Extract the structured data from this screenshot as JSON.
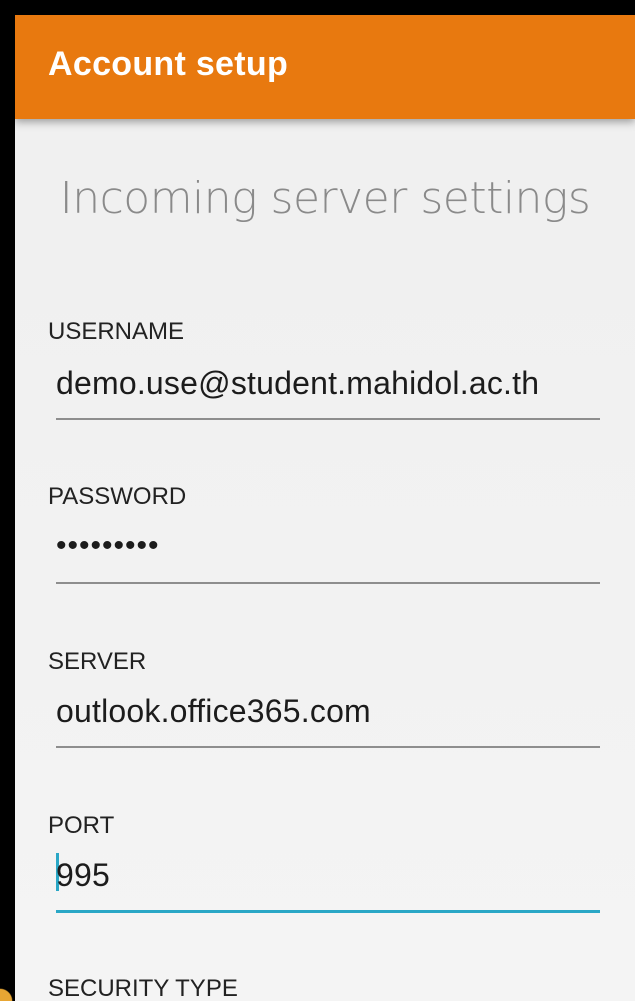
{
  "appbar": {
    "title": "Account setup"
  },
  "page": {
    "heading": "Incoming server settings"
  },
  "fields": {
    "username": {
      "label": "USERNAME",
      "value": "demo.use@student.mahidol.ac.th"
    },
    "password": {
      "label": "PASSWORD",
      "value": "•••••••••"
    },
    "server": {
      "label": "SERVER",
      "value": "outlook.office365.com"
    },
    "port": {
      "label": "PORT",
      "value": "995"
    },
    "security_type": {
      "label": "SECURITY TYPE"
    }
  },
  "colors": {
    "appbar": "#e8790f",
    "focus_underline": "#2aa7c6"
  }
}
